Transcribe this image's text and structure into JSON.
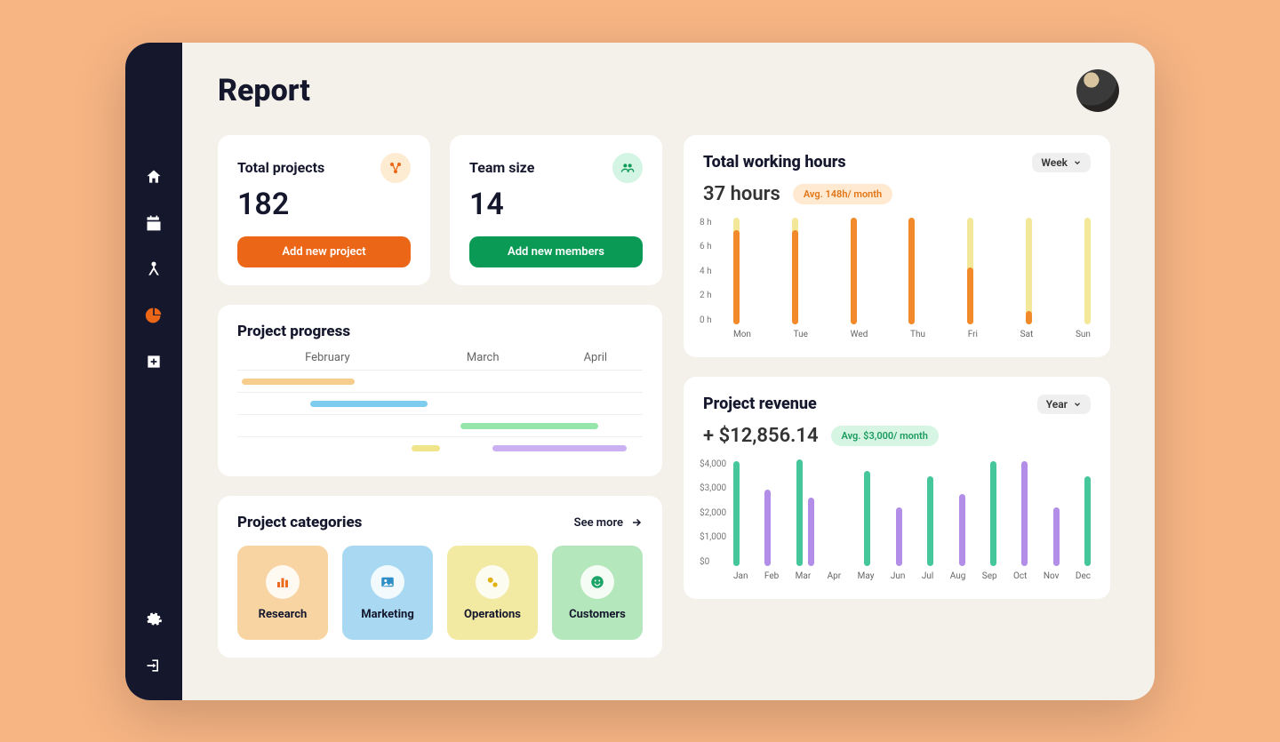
{
  "page_title": "Report",
  "sidebar": {
    "items": [
      {
        "name": "home-icon"
      },
      {
        "name": "calendar-icon"
      },
      {
        "name": "drafting-icon"
      },
      {
        "name": "pie-chart-icon",
        "active": true
      },
      {
        "name": "add-square-icon"
      }
    ],
    "bottom": [
      {
        "name": "gear-icon"
      },
      {
        "name": "logout-icon"
      }
    ]
  },
  "stats": {
    "projects": {
      "label": "Total projects",
      "value": "182",
      "button": "Add new project"
    },
    "team": {
      "label": "Team size",
      "value": "14",
      "button": "Add new members"
    }
  },
  "progress": {
    "title": "Project progress",
    "months": [
      "February",
      "March",
      "April"
    ],
    "bars": [
      {
        "left_pct": 1,
        "width_pct": 28,
        "color": "#f6cd8c"
      },
      {
        "left_pct": 18,
        "width_pct": 29,
        "color": "#7fcdee"
      },
      {
        "left_pct": 55,
        "width_pct": 34,
        "color": "#95e6ab"
      },
      {
        "left_pct": 43,
        "width_pct": 7,
        "color": "#f1e58c"
      },
      {
        "left_pct": 63,
        "width_pct": 33,
        "color": "#cbb1f2"
      }
    ]
  },
  "categories": {
    "title": "Project categories",
    "see_more": "See more",
    "items": [
      {
        "label": "Research",
        "bg": "#f7d4a2",
        "icon_color": "#ec6a1e",
        "icon": "bar-chart-icon"
      },
      {
        "label": "Marketing",
        "bg": "#a9d9f2",
        "icon_color": "#2f8ec8",
        "icon": "image-icon"
      },
      {
        "label": "Operations",
        "bg": "#f2e9a2",
        "icon_color": "#e0b214",
        "icon": "gears-icon"
      },
      {
        "label": "Customers",
        "bg": "#b4e7bb",
        "icon_color": "#1aa567",
        "icon": "smile-icon"
      }
    ]
  },
  "hours_card": {
    "title": "Total working hours",
    "select": "Week",
    "headline": "37 hours",
    "badge": "Avg. 148h/ month"
  },
  "revenue_card": {
    "title": "Project revenue",
    "select": "Year",
    "headline": "+ $12,856.14",
    "badge": "Avg. $3,000/ month"
  },
  "chart_data": [
    {
      "id": "hours",
      "type": "bar",
      "title": "Total working hours",
      "xlabel": "",
      "ylabel": "hours",
      "categories": [
        "Mon",
        "Tue",
        "Wed",
        "Thu",
        "Fri",
        "Sat",
        "Sun"
      ],
      "yticks": [
        "8 h",
        "6 h",
        "4 h",
        "2 h",
        "0 h"
      ],
      "ylim": [
        0,
        8.5
      ],
      "series": [
        {
          "name": "capacity",
          "color": "#f3e79a",
          "values": [
            8.5,
            8.5,
            8.5,
            8.5,
            8.5,
            8.5,
            8.5
          ]
        },
        {
          "name": "actual",
          "color": "#f28a2b",
          "values": [
            7.5,
            7.5,
            8.5,
            8.5,
            4.5,
            1.0,
            0.0
          ]
        }
      ],
      "stacked_overlay": true
    },
    {
      "id": "revenue",
      "type": "bar",
      "title": "Project revenue",
      "xlabel": "",
      "ylabel": "USD",
      "categories": [
        "Jan",
        "Feb",
        "Mar",
        "Apr",
        "May",
        "Jun",
        "Jul",
        "Aug",
        "Sep",
        "Oct",
        "Nov",
        "Dec"
      ],
      "yticks": [
        "$4,000",
        "$3,000",
        "$2,000",
        "$1,000",
        "$0"
      ],
      "ylim": [
        0,
        4300
      ],
      "series": [
        {
          "name": "teal",
          "color": "#46c79b",
          "values": [
            4200,
            null,
            4300,
            null,
            3800,
            null,
            3600,
            null,
            4200,
            null,
            null,
            3600
          ]
        },
        {
          "name": "purple",
          "color": "#b38ee8",
          "values": [
            null,
            3050,
            2750,
            null,
            null,
            2350,
            null,
            2900,
            null,
            4200,
            2350,
            null
          ]
        }
      ],
      "stacked_overlay": false
    }
  ]
}
